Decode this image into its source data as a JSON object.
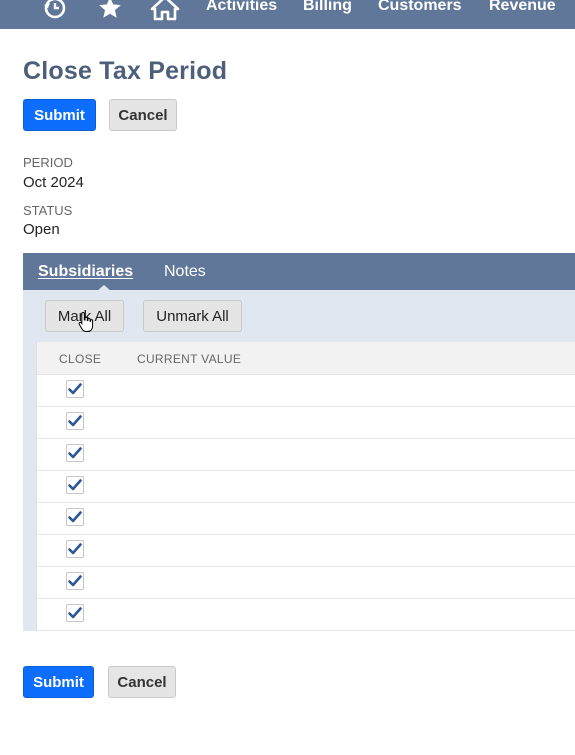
{
  "nav": {
    "links": [
      "Activities",
      "Billing",
      "Customers",
      "Revenue"
    ],
    "icons": [
      "recent-history-icon",
      "favorites-star-icon",
      "home-icon"
    ]
  },
  "page": {
    "title": "Close Tax Period"
  },
  "buttons": {
    "submit": "Submit",
    "cancel": "Cancel"
  },
  "fields": {
    "period": {
      "label": "PERIOD",
      "value": "Oct 2024"
    },
    "status": {
      "label": "STATUS",
      "value": "Open"
    }
  },
  "tabs": {
    "subsidiaries": "Subsidiaries",
    "notes": "Notes",
    "active": "subsidiaries"
  },
  "list_actions": {
    "mark_all": "Mark All",
    "unmark_all": "Unmark All"
  },
  "table": {
    "columns": [
      "CLOSE",
      "CURRENT VALUE"
    ],
    "rows": [
      {
        "close": true,
        "current_value": ""
      },
      {
        "close": true,
        "current_value": ""
      },
      {
        "close": true,
        "current_value": ""
      },
      {
        "close": true,
        "current_value": ""
      },
      {
        "close": true,
        "current_value": ""
      },
      {
        "close": true,
        "current_value": ""
      },
      {
        "close": true,
        "current_value": ""
      },
      {
        "close": true,
        "current_value": ""
      }
    ]
  },
  "colors": {
    "nav_bg": "#607799",
    "primary": "#0d6efd",
    "title": "#4d5f7a",
    "subtab_bg": "#e1e7f0",
    "check": "#2b5797"
  }
}
